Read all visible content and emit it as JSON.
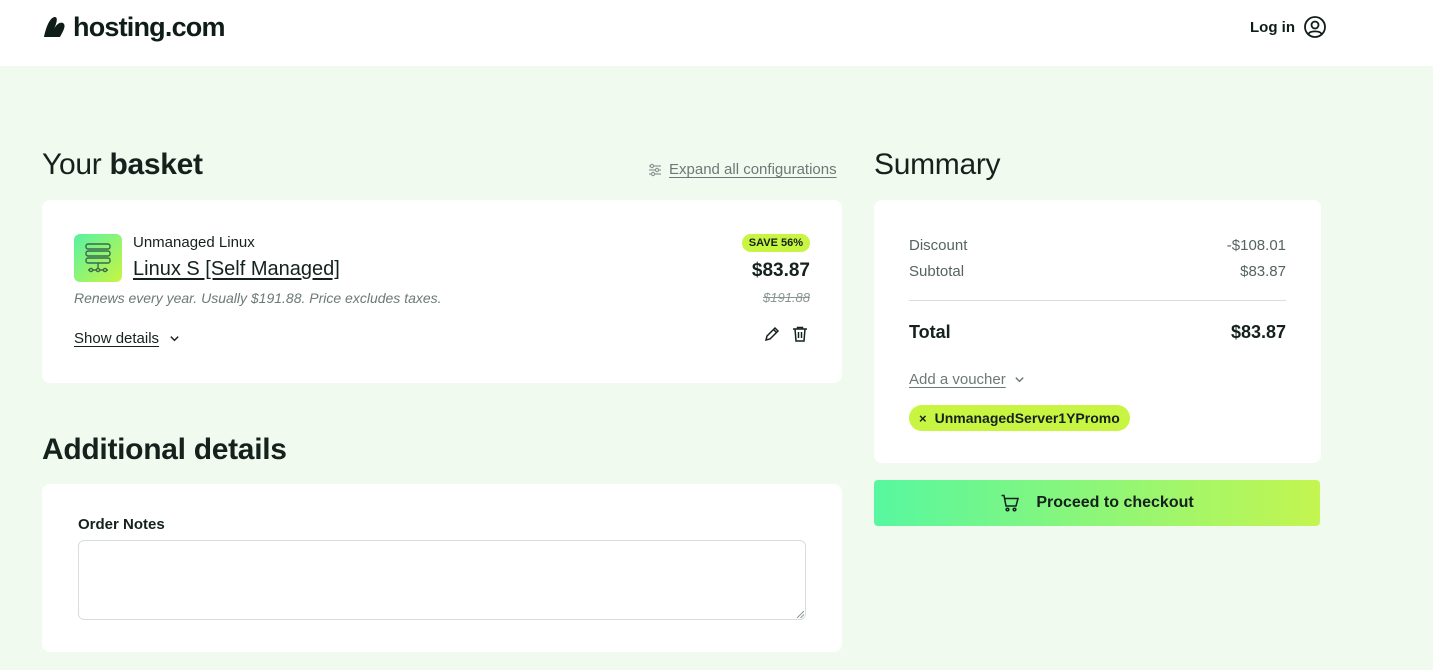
{
  "header": {
    "logo_text": "hosting.com",
    "login_label": "Log in"
  },
  "basket": {
    "title_light": "Your",
    "title_bold": "basket",
    "expand_label": "Expand all configurations",
    "item": {
      "category": "Unmanaged Linux",
      "name": "Linux S [Self Managed]",
      "renew_note": "Renews every year. Usually $191.88. Price excludes taxes.",
      "save_badge": "SAVE 56%",
      "price": "$83.87",
      "old_price": "$191.88",
      "show_details_label": "Show details"
    }
  },
  "additional": {
    "title_bold": "Additional",
    "title_light": "details",
    "notes_label": "Order Notes",
    "notes_value": ""
  },
  "summary": {
    "title": "Summary",
    "discount_label": "Discount",
    "discount_value": "-$108.01",
    "subtotal_label": "Subtotal",
    "subtotal_value": "$83.87",
    "total_label": "Total",
    "total_value": "$83.87",
    "voucher_label": "Add a voucher",
    "promo_code": "UnmanagedServer1YPromo",
    "promo_remove": "×",
    "checkout_label": "Proceed to checkout"
  },
  "colors": {
    "page_bg": "#f0faef",
    "accent_lime": "#c8f542",
    "accent_green": "#57f7a0",
    "text_dark": "#14211d"
  },
  "icons": {
    "logo": "hosting-logo-mark",
    "login": "user-circle-icon",
    "expand": "sliders-icon",
    "show_details": "chevron-down-icon",
    "edit": "pencil-icon",
    "delete": "trash-icon",
    "voucher": "chevron-down-icon",
    "checkout": "cart-icon",
    "product": "server-stack-icon"
  }
}
